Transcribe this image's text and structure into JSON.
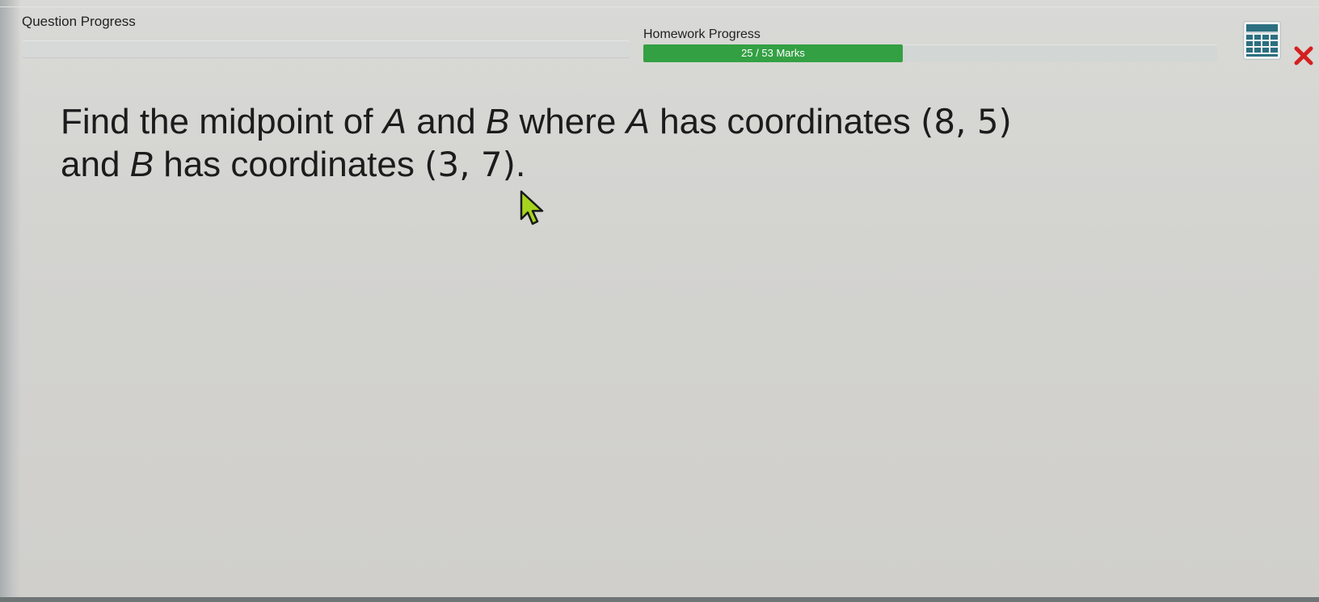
{
  "header": {
    "question_progress_label": "Question Progress",
    "homework_progress_label": "Homework Progress",
    "homework_progress_text": "25 / 53 Marks",
    "homework_progress_fraction": 0.4528,
    "fill_color": "#33a043"
  },
  "toolbar": {
    "calculator_icon": "calculator-icon",
    "close_icon": "close-icon",
    "close_color": "#d32020"
  },
  "question": {
    "line1_text1": "Find the midpoint of ",
    "var_a": "A",
    "line1_text2": " and ",
    "var_b": "B",
    "line1_text3": " where ",
    "line1_text4": " has coordinates ",
    "coord_a": "(8, 5)",
    "line2_text1": "and ",
    "line2_text2": " has coordinates ",
    "coord_b": "(3, 7)",
    "period": "."
  },
  "cursor": {
    "icon": "mouse-pointer-icon",
    "color": "#a6d41e"
  }
}
